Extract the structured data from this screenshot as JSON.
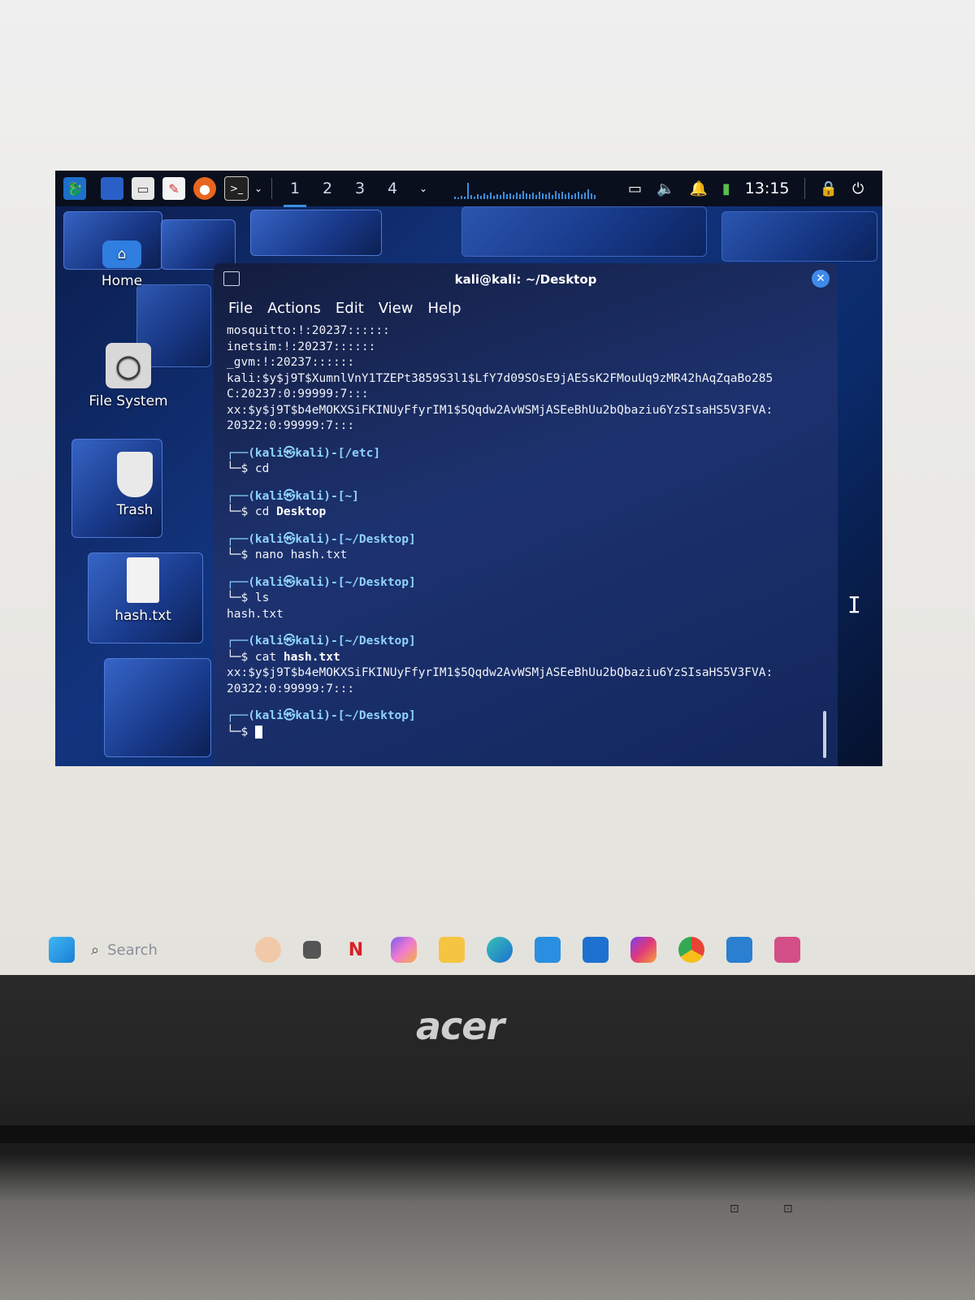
{
  "kali_panel": {
    "workspaces": [
      "1",
      "2",
      "3",
      "4"
    ],
    "active_workspace": "1",
    "clock": "13:15"
  },
  "desktop_icons": [
    {
      "label": "Home"
    },
    {
      "label": "File System"
    },
    {
      "label": "Trash"
    },
    {
      "label": "hash.txt"
    }
  ],
  "terminal": {
    "title": "kali@kali: ~/Desktop",
    "menu": [
      "File",
      "Actions",
      "Edit",
      "View",
      "Help"
    ],
    "lines": {
      "l1": "mosquitto:!:20237::::::",
      "l2": "inetsim:!:20237::::::",
      "l3": "_gvm:!:20237::::::",
      "l4": "kali:$y$j9T$XumnlVnY1TZEPt3859S3l1$LfY7d09SOsE9jAESsK2FMouUq9zMR42hAqZqaBo285",
      "l5": "C:20237:0:99999:7:::",
      "l6": "xx:$y$j9T$b4eMOKXSiFKINUyFfyrIM1$5Qqdw2AvWSMjASEeBhUu2bQbaziu6YzSIsaHS5V3FVA:",
      "l7": "20322:0:99999:7:::",
      "p1": "┌──(kali㉿kali)-[/etc]",
      "c1": "└─$ cd",
      "p2": "┌──(kali㉿kali)-[~]",
      "c2a": "└─$ cd ",
      "c2b": "Desktop",
      "p3": "┌──(kali㉿kali)-[~/Desktop]",
      "c3a": "└─$ nano ",
      "c3b": "hash.txt",
      "p4": "┌──(kali㉿kali)-[~/Desktop]",
      "c4": "└─$ ls",
      "o4": "hash.txt",
      "p5": "┌──(kali㉿kali)-[~/Desktop]",
      "c5a": "└─$ cat ",
      "c5b": "hash.txt",
      "o5a": "xx:$y$j9T$b4eMOKXSiFKINUyFfyrIM1$5Qqdw2AvWSMjASEeBhUu2bQbaziu6YzSIsaHS5V3FVA:",
      "o5b": "20322:0:99999:7:::",
      "p6": "┌──(kali㉿kali)-[~/Desktop]",
      "c6": "└─$ "
    }
  },
  "windows_taskbar": {
    "search_placeholder": "Search",
    "apps": [
      "N"
    ]
  },
  "laptop": {
    "brand": "acer"
  }
}
